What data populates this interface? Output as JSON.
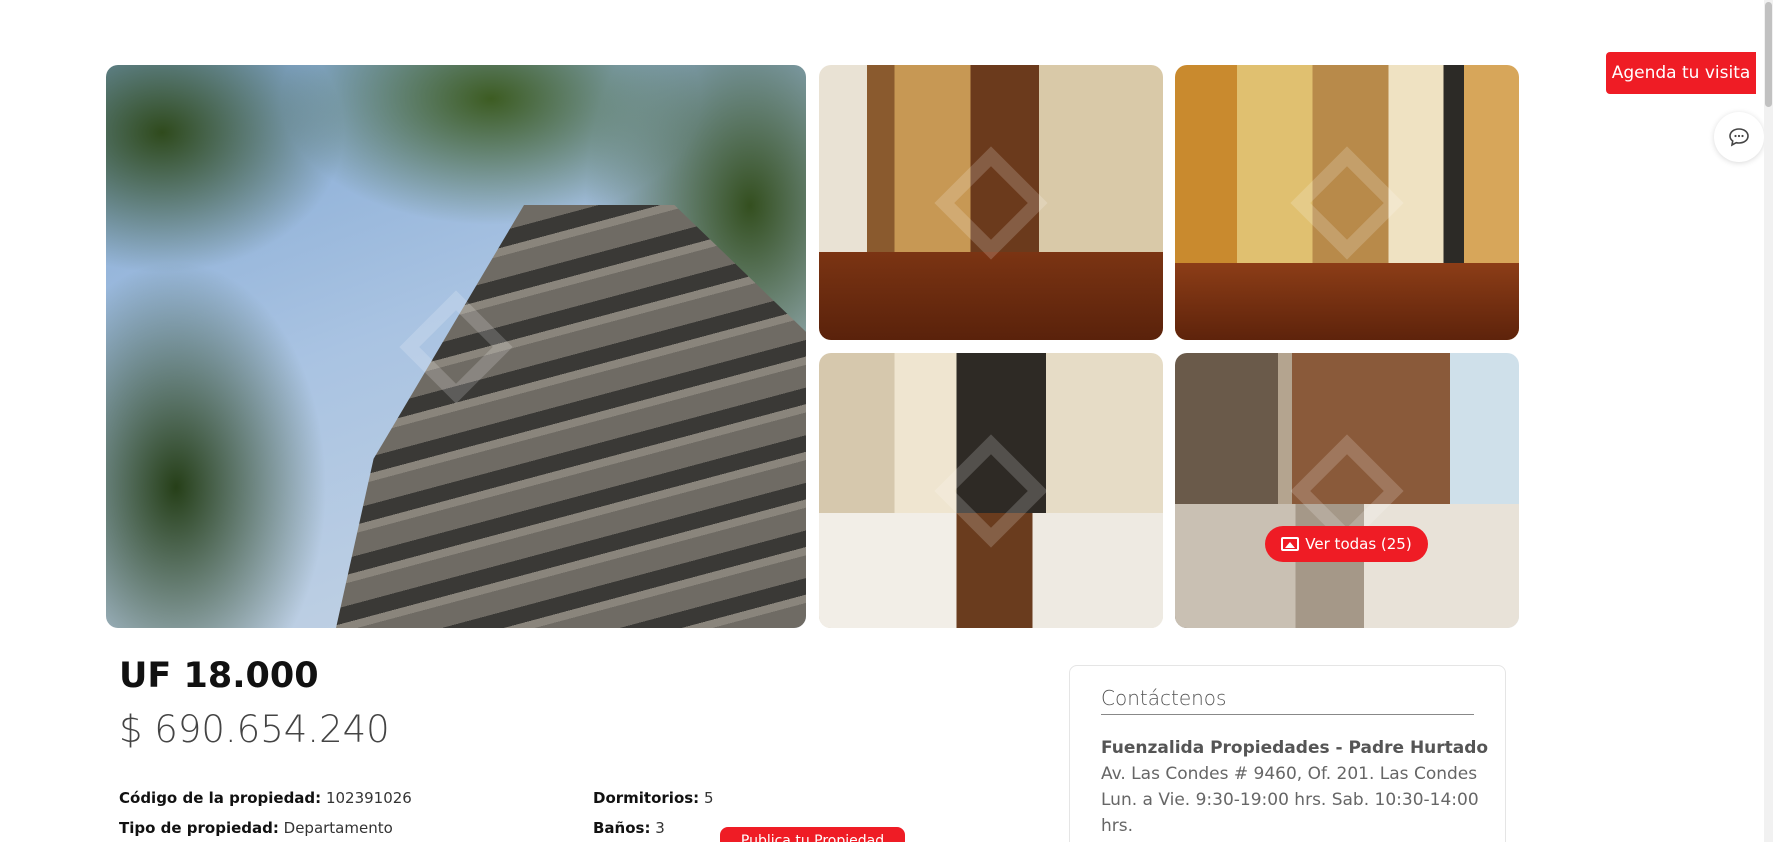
{
  "gallery": {
    "view_all_label": "Ver todas (25)",
    "photos": [
      "building-exterior",
      "entry-hallway",
      "hallway-stairs",
      "living-room",
      "terrace-lounge"
    ]
  },
  "floating": {
    "agenda_label": "Agenda tu visita",
    "chat_icon": "chat-bubble-icon"
  },
  "price": {
    "uf": "UF 18.000",
    "clp": "$ 690.654.240"
  },
  "specs": {
    "code_label": "Código de la propiedad:",
    "code_value": "102391026",
    "type_label": "Tipo de propiedad:",
    "type_value": "Departamento",
    "bedrooms_label": "Dormitorios:",
    "bedrooms_value": "5",
    "baths_label": "Baños:",
    "baths_value": "3"
  },
  "publish_label": "Publica tu Propiedad",
  "contact": {
    "title": "Contáctenos",
    "name": "Fuenzalida Propiedades - Padre Hurtado",
    "address": "Av. Las Condes # 9460, Of. 201. Las Condes",
    "hours_1": "Lun. a Vie. 9:30-19:00 hrs. Sab. 10:30-14:00",
    "hours_2": "hrs."
  },
  "colors": {
    "accent": "#ef1c25"
  }
}
